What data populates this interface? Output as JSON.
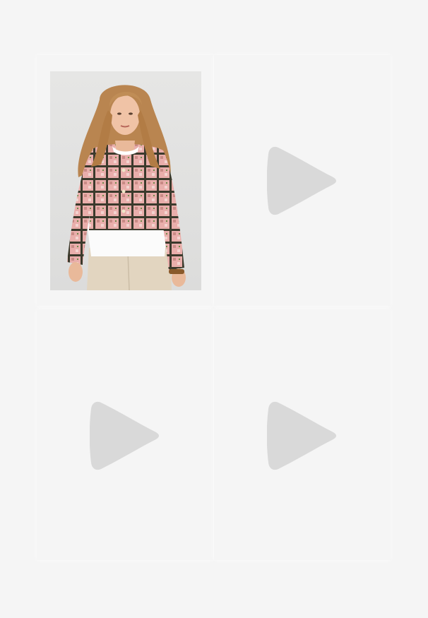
{
  "gallery": {
    "items": [
      {
        "kind": "image",
        "icon": "product-photo"
      },
      {
        "kind": "video",
        "icon": "play-icon"
      },
      {
        "kind": "video",
        "icon": "play-icon"
      },
      {
        "kind": "video",
        "icon": "play-icon"
      }
    ]
  },
  "colors": {
    "background": "#f5f5f5",
    "placeholder_icon": "#d9d9d9",
    "jacket_pink": "#e8a7a6",
    "jacket_check": "#3b3a2c",
    "trousers": "#e2d5c0",
    "hair": "#b98550"
  }
}
